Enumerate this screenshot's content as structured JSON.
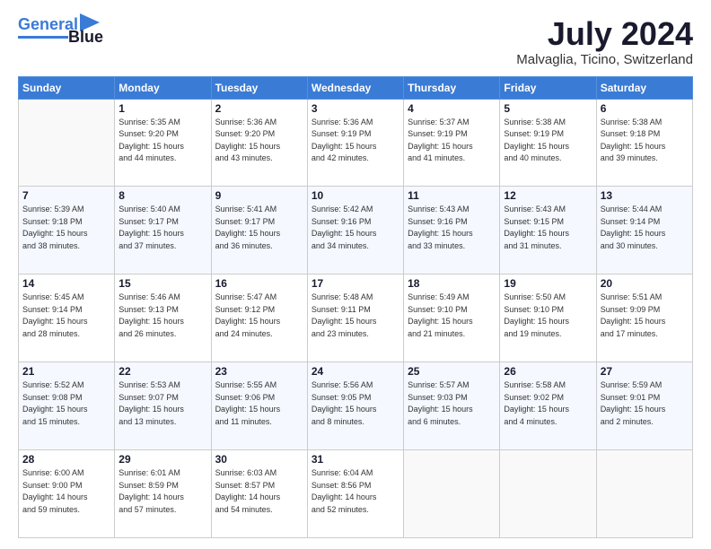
{
  "header": {
    "logo": {
      "line1": "General",
      "line2": "Blue"
    },
    "title": "July 2024",
    "subtitle": "Malvaglia, Ticino, Switzerland"
  },
  "calendar": {
    "days_of_week": [
      "Sunday",
      "Monday",
      "Tuesday",
      "Wednesday",
      "Thursday",
      "Friday",
      "Saturday"
    ],
    "weeks": [
      [
        {
          "day": "",
          "sunrise": "",
          "sunset": "",
          "daylight": ""
        },
        {
          "day": "1",
          "sunrise": "Sunrise: 5:35 AM",
          "sunset": "Sunset: 9:20 PM",
          "daylight": "Daylight: 15 hours and 44 minutes."
        },
        {
          "day": "2",
          "sunrise": "Sunrise: 5:36 AM",
          "sunset": "Sunset: 9:20 PM",
          "daylight": "Daylight: 15 hours and 43 minutes."
        },
        {
          "day": "3",
          "sunrise": "Sunrise: 5:36 AM",
          "sunset": "Sunset: 9:19 PM",
          "daylight": "Daylight: 15 hours and 42 minutes."
        },
        {
          "day": "4",
          "sunrise": "Sunrise: 5:37 AM",
          "sunset": "Sunset: 9:19 PM",
          "daylight": "Daylight: 15 hours and 41 minutes."
        },
        {
          "day": "5",
          "sunrise": "Sunrise: 5:38 AM",
          "sunset": "Sunset: 9:19 PM",
          "daylight": "Daylight: 15 hours and 40 minutes."
        },
        {
          "day": "6",
          "sunrise": "Sunrise: 5:38 AM",
          "sunset": "Sunset: 9:18 PM",
          "daylight": "Daylight: 15 hours and 39 minutes."
        }
      ],
      [
        {
          "day": "7",
          "sunrise": "Sunrise: 5:39 AM",
          "sunset": "Sunset: 9:18 PM",
          "daylight": "Daylight: 15 hours and 38 minutes."
        },
        {
          "day": "8",
          "sunrise": "Sunrise: 5:40 AM",
          "sunset": "Sunset: 9:17 PM",
          "daylight": "Daylight: 15 hours and 37 minutes."
        },
        {
          "day": "9",
          "sunrise": "Sunrise: 5:41 AM",
          "sunset": "Sunset: 9:17 PM",
          "daylight": "Daylight: 15 hours and 36 minutes."
        },
        {
          "day": "10",
          "sunrise": "Sunrise: 5:42 AM",
          "sunset": "Sunset: 9:16 PM",
          "daylight": "Daylight: 15 hours and 34 minutes."
        },
        {
          "day": "11",
          "sunrise": "Sunrise: 5:43 AM",
          "sunset": "Sunset: 9:16 PM",
          "daylight": "Daylight: 15 hours and 33 minutes."
        },
        {
          "day": "12",
          "sunrise": "Sunrise: 5:43 AM",
          "sunset": "Sunset: 9:15 PM",
          "daylight": "Daylight: 15 hours and 31 minutes."
        },
        {
          "day": "13",
          "sunrise": "Sunrise: 5:44 AM",
          "sunset": "Sunset: 9:14 PM",
          "daylight": "Daylight: 15 hours and 30 minutes."
        }
      ],
      [
        {
          "day": "14",
          "sunrise": "Sunrise: 5:45 AM",
          "sunset": "Sunset: 9:14 PM",
          "daylight": "Daylight: 15 hours and 28 minutes."
        },
        {
          "day": "15",
          "sunrise": "Sunrise: 5:46 AM",
          "sunset": "Sunset: 9:13 PM",
          "daylight": "Daylight: 15 hours and 26 minutes."
        },
        {
          "day": "16",
          "sunrise": "Sunrise: 5:47 AM",
          "sunset": "Sunset: 9:12 PM",
          "daylight": "Daylight: 15 hours and 24 minutes."
        },
        {
          "day": "17",
          "sunrise": "Sunrise: 5:48 AM",
          "sunset": "Sunset: 9:11 PM",
          "daylight": "Daylight: 15 hours and 23 minutes."
        },
        {
          "day": "18",
          "sunrise": "Sunrise: 5:49 AM",
          "sunset": "Sunset: 9:10 PM",
          "daylight": "Daylight: 15 hours and 21 minutes."
        },
        {
          "day": "19",
          "sunrise": "Sunrise: 5:50 AM",
          "sunset": "Sunset: 9:10 PM",
          "daylight": "Daylight: 15 hours and 19 minutes."
        },
        {
          "day": "20",
          "sunrise": "Sunrise: 5:51 AM",
          "sunset": "Sunset: 9:09 PM",
          "daylight": "Daylight: 15 hours and 17 minutes."
        }
      ],
      [
        {
          "day": "21",
          "sunrise": "Sunrise: 5:52 AM",
          "sunset": "Sunset: 9:08 PM",
          "daylight": "Daylight: 15 hours and 15 minutes."
        },
        {
          "day": "22",
          "sunrise": "Sunrise: 5:53 AM",
          "sunset": "Sunset: 9:07 PM",
          "daylight": "Daylight: 15 hours and 13 minutes."
        },
        {
          "day": "23",
          "sunrise": "Sunrise: 5:55 AM",
          "sunset": "Sunset: 9:06 PM",
          "daylight": "Daylight: 15 hours and 11 minutes."
        },
        {
          "day": "24",
          "sunrise": "Sunrise: 5:56 AM",
          "sunset": "Sunset: 9:05 PM",
          "daylight": "Daylight: 15 hours and 8 minutes."
        },
        {
          "day": "25",
          "sunrise": "Sunrise: 5:57 AM",
          "sunset": "Sunset: 9:03 PM",
          "daylight": "Daylight: 15 hours and 6 minutes."
        },
        {
          "day": "26",
          "sunrise": "Sunrise: 5:58 AM",
          "sunset": "Sunset: 9:02 PM",
          "daylight": "Daylight: 15 hours and 4 minutes."
        },
        {
          "day": "27",
          "sunrise": "Sunrise: 5:59 AM",
          "sunset": "Sunset: 9:01 PM",
          "daylight": "Daylight: 15 hours and 2 minutes."
        }
      ],
      [
        {
          "day": "28",
          "sunrise": "Sunrise: 6:00 AM",
          "sunset": "Sunset: 9:00 PM",
          "daylight": "Daylight: 14 hours and 59 minutes."
        },
        {
          "day": "29",
          "sunrise": "Sunrise: 6:01 AM",
          "sunset": "Sunset: 8:59 PM",
          "daylight": "Daylight: 14 hours and 57 minutes."
        },
        {
          "day": "30",
          "sunrise": "Sunrise: 6:03 AM",
          "sunset": "Sunset: 8:57 PM",
          "daylight": "Daylight: 14 hours and 54 minutes."
        },
        {
          "day": "31",
          "sunrise": "Sunrise: 6:04 AM",
          "sunset": "Sunset: 8:56 PM",
          "daylight": "Daylight: 14 hours and 52 minutes."
        },
        {
          "day": "",
          "sunrise": "",
          "sunset": "",
          "daylight": ""
        },
        {
          "day": "",
          "sunrise": "",
          "sunset": "",
          "daylight": ""
        },
        {
          "day": "",
          "sunrise": "",
          "sunset": "",
          "daylight": ""
        }
      ]
    ]
  }
}
